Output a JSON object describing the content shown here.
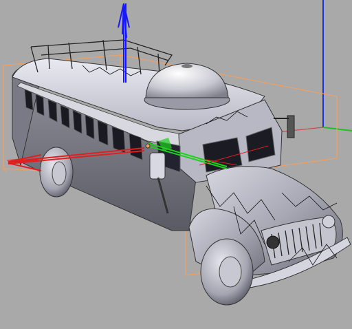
{
  "viewport": {
    "background": "#a9a9a9",
    "object": "bus-model",
    "selection_color": "#f0a060",
    "axis_colors": {
      "x": "#e02020",
      "y": "#20c020",
      "z": "#2030e0"
    },
    "gizmo_colors": {
      "x": "#e02020",
      "y": "#20d020",
      "z": "#1818ff"
    },
    "shading": "solid-gray-metallic"
  }
}
